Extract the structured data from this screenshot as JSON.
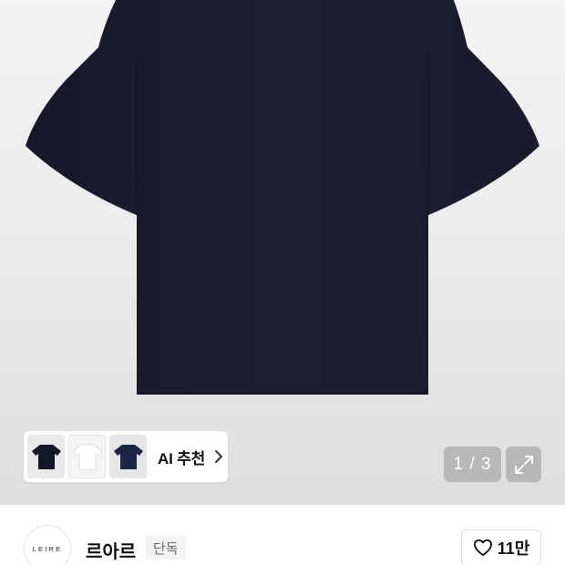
{
  "gallery": {
    "image_desc": "navy-short-sleeve-tshirt",
    "counter": "1 / 3",
    "expand_icon": "expand-arrows-icon"
  },
  "ai_recommend": {
    "label": "AI 추천",
    "thumb_colors": [
      "#151826",
      "#ffffff",
      "#1d2644"
    ]
  },
  "brand": {
    "logo_text": "LEIRE",
    "name": "르아르",
    "badge": "단독"
  },
  "like": {
    "count": "11만"
  },
  "colors": {
    "shirt": "#1b1f2e",
    "background": "#ececec"
  }
}
